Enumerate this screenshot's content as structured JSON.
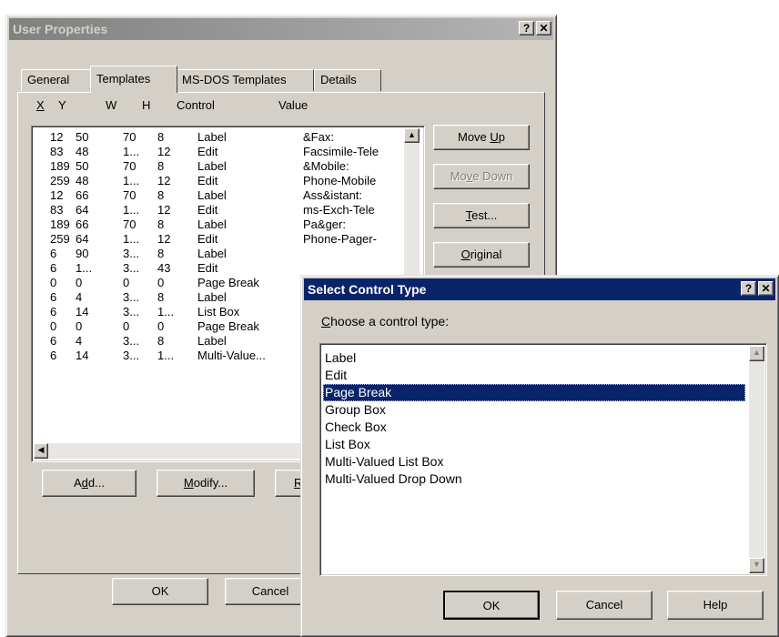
{
  "main_window": {
    "title": "User Properties",
    "help_btn": "?",
    "close_btn": "✕",
    "tabs": [
      "General",
      "Templates",
      "MS-DOS Templates",
      "Details"
    ],
    "columns": [
      "X",
      "Y",
      "W",
      "H",
      "Control",
      "Value"
    ],
    "rows": [
      {
        "x": "12",
        "y": "50",
        "w": "70",
        "h": "8",
        "control": "Label",
        "value": "&Fax:"
      },
      {
        "x": "83",
        "y": "48",
        "w": "1...",
        "h": "12",
        "control": "Edit",
        "value": "Facsimile-Tele"
      },
      {
        "x": "189",
        "y": "50",
        "w": "70",
        "h": "8",
        "control": "Label",
        "value": "&Mobile:"
      },
      {
        "x": "259",
        "y": "48",
        "w": "1...",
        "h": "12",
        "control": "Edit",
        "value": "Phone-Mobile"
      },
      {
        "x": "12",
        "y": "66",
        "w": "70",
        "h": "8",
        "control": "Label",
        "value": "Ass&istant:"
      },
      {
        "x": "83",
        "y": "64",
        "w": "1...",
        "h": "12",
        "control": "Edit",
        "value": "ms-Exch-Tele"
      },
      {
        "x": "189",
        "y": "66",
        "w": "70",
        "h": "8",
        "control": "Label",
        "value": "Pa&ger:"
      },
      {
        "x": "259",
        "y": "64",
        "w": "1...",
        "h": "12",
        "control": "Edit",
        "value": "Phone-Pager-"
      },
      {
        "x": "6",
        "y": "90",
        "w": "3...",
        "h": "8",
        "control": "Label",
        "value": ""
      },
      {
        "x": "6",
        "y": "1...",
        "w": "3...",
        "h": "43",
        "control": "Edit",
        "value": ""
      },
      {
        "x": "0",
        "y": "0",
        "w": "0",
        "h": "0",
        "control": "Page Break",
        "value": ""
      },
      {
        "x": "6",
        "y": "4",
        "w": "3...",
        "h": "8",
        "control": "Label",
        "value": ""
      },
      {
        "x": "6",
        "y": "14",
        "w": "3...",
        "h": "1...",
        "control": "List Box",
        "value": ""
      },
      {
        "x": "0",
        "y": "0",
        "w": "0",
        "h": "0",
        "control": "Page Break",
        "value": ""
      },
      {
        "x": "6",
        "y": "4",
        "w": "3...",
        "h": "8",
        "control": "Label",
        "value": ""
      },
      {
        "x": "6",
        "y": "14",
        "w": "3...",
        "h": "1...",
        "control": "Multi-Value...",
        "value": ""
      }
    ],
    "side_buttons": {
      "move_up": "Move Up",
      "move_down": "Move Down",
      "test": "Test...",
      "original": "Original"
    },
    "bottom_buttons": {
      "add": "Add...",
      "modify": "Modify...",
      "remove_partial": "Re"
    },
    "footer_buttons": {
      "ok": "OK",
      "cancel": "Cancel"
    }
  },
  "dialog": {
    "title": "Select Control Type",
    "help_btn": "?",
    "close_btn": "✕",
    "prompt": "Choose a control type:",
    "options": [
      "Label",
      "Edit",
      "Page Break",
      "Group Box",
      "Check Box",
      "List Box",
      "Multi-Valued List Box",
      "Multi-Valued Drop Down"
    ],
    "selected": "Page Break",
    "buttons": {
      "ok": "OK",
      "cancel": "Cancel",
      "help": "Help"
    }
  }
}
